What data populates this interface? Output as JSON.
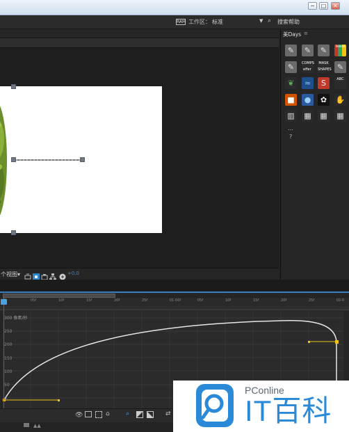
{
  "titlebar": {
    "controls": [
      "─",
      "□",
      "✕"
    ]
  },
  "menubar": {
    "workspace_icon": "RAM",
    "workspace_label": "工作区：",
    "workspace_value": "标准",
    "search_help": "搜索帮助"
  },
  "composition": {
    "view_label": "个视图▾",
    "zoom_label": "+0.0"
  },
  "right_panel": {
    "tab_label": "美Days",
    "tab_menu": "≡",
    "tools": [
      {
        "icon": "pencil-icon",
        "label": ""
      },
      {
        "icon": "pencil-icon",
        "label": ""
      },
      {
        "icon": "pencil-icon",
        "label": ""
      },
      {
        "icon": "leave-color-icon",
        "label": "leave"
      },
      {
        "icon": "pencil-icon",
        "label": ""
      },
      {
        "icon": "comps-icon",
        "label": "COMPS"
      },
      {
        "icon": "mask-shapes-icon",
        "label": "MASK"
      },
      {
        "icon": "pencil-icon",
        "label": ""
      },
      {
        "icon": "leaf-icon",
        "label": ""
      },
      {
        "icon": "waves-icon",
        "label": ""
      },
      {
        "icon": "red-logo-icon",
        "label": ""
      },
      {
        "icon": "abc-icon",
        "label": "ABC"
      },
      {
        "icon": "orange-box-icon",
        "label": ""
      },
      {
        "icon": "blue-globe-icon",
        "label": ""
      },
      {
        "icon": "flower-icon",
        "label": ""
      },
      {
        "icon": "yellow-hand-icon",
        "label": ""
      },
      {
        "icon": "bars-icon",
        "label": ""
      },
      {
        "icon": "grid-4-icon",
        "label": ""
      },
      {
        "icon": "grid-4-icon",
        "label": ""
      },
      {
        "icon": "grid-9-icon",
        "label": ""
      }
    ],
    "sub_labels": {
      "comps": "effer",
      "mask": "SHAPES"
    },
    "more": "...",
    "help": "?"
  },
  "graph_editor": {
    "ruler_ticks": [
      "0f",
      "05f",
      "10f",
      "15f",
      "20f",
      "25f",
      "01:00f",
      "05f",
      "10f",
      "15f",
      "20f",
      "25f",
      "02:0"
    ],
    "unit_label": "300 像素/秒",
    "y_ticks": [
      "250",
      "200",
      "150",
      "100",
      "50",
      "0"
    ]
  },
  "watermark": {
    "brand": "PConline",
    "title": "IT百科"
  },
  "colors": {
    "accent_blue": "#3a7fc0",
    "curve": "#e6e6e6",
    "keyframe_yellow": "#f2c21b",
    "playhead_red": "#c0392b"
  }
}
